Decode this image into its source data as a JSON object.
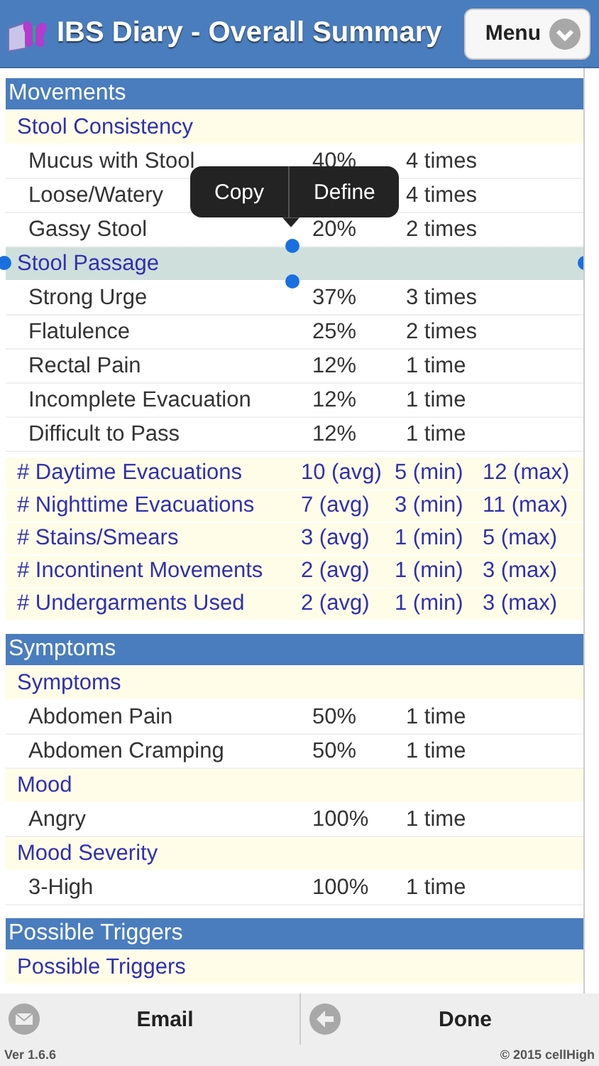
{
  "header": {
    "title": "IBS Diary - Overall Summary",
    "menu_button": "Menu"
  },
  "sections": [
    {
      "title": "Movements",
      "rows": [
        {
          "kind": "group",
          "label": "Stool Consistency",
          "selected": false
        },
        {
          "kind": "item",
          "label": "Mucus with Stool",
          "percent": "40%",
          "count": "4 times"
        },
        {
          "kind": "item",
          "label": "Loose/Watery",
          "count": "4 times"
        },
        {
          "kind": "item",
          "label": "Gassy Stool",
          "percent": "20%",
          "count": "2 times"
        },
        {
          "kind": "group",
          "label": "Stool Passage",
          "selected": true
        },
        {
          "kind": "item",
          "label": "Strong Urge",
          "percent": "37%",
          "count": "3 times"
        },
        {
          "kind": "item",
          "label": "Flatulence",
          "percent": "25%",
          "count": "2 times"
        },
        {
          "kind": "item",
          "label": "Rectal Pain",
          "percent": "12%",
          "count": "1 time"
        },
        {
          "kind": "item",
          "label": "Incomplete Evacuation",
          "percent": "12%",
          "count": "1 time"
        },
        {
          "kind": "item",
          "label": "Difficult to Pass",
          "percent": "12%",
          "count": "1 time"
        },
        {
          "kind": "stat",
          "label": "# Daytime Evacuations",
          "avg": "10 (avg)",
          "min": "5 (min)",
          "max": "12 (max)"
        },
        {
          "kind": "stat",
          "label": "# Nighttime Evacuations",
          "avg": "7 (avg)",
          "min": "3 (min)",
          "max": "11 (max)"
        },
        {
          "kind": "stat",
          "label": "# Stains/Smears",
          "avg": "3 (avg)",
          "min": "1 (min)",
          "max": "5 (max)"
        },
        {
          "kind": "stat",
          "label": "# Incontinent Movements",
          "avg": "2 (avg)",
          "min": "1 (min)",
          "max": "3 (max)"
        },
        {
          "kind": "stat",
          "label": "# Undergarments Used",
          "avg": "2 (avg)",
          "min": "1 (min)",
          "max": "3 (max)"
        }
      ]
    },
    {
      "title": "Symptoms",
      "rows": [
        {
          "kind": "group",
          "label": "Symptoms",
          "selected": false
        },
        {
          "kind": "item",
          "label": "Abdomen Pain",
          "percent": "50%",
          "count": "1 time"
        },
        {
          "kind": "item",
          "label": "Abdomen Cramping",
          "percent": "50%",
          "count": "1 time"
        },
        {
          "kind": "group",
          "label": "Mood",
          "selected": false
        },
        {
          "kind": "item",
          "label": "Angry",
          "percent": "100%",
          "count": "1 time"
        },
        {
          "kind": "group",
          "label": "Mood Severity",
          "selected": false
        },
        {
          "kind": "item",
          "label": "3-High",
          "percent": "100%",
          "count": "1 time"
        }
      ]
    },
    {
      "title": "Possible Triggers",
      "rows": [
        {
          "kind": "group",
          "label": "Possible Triggers",
          "selected": false
        }
      ]
    }
  ],
  "edit_menu": {
    "actions": [
      "Copy",
      "Define"
    ]
  },
  "footer": {
    "email_button": "Email",
    "done_button": "Done",
    "version": "Ver 1.6.6",
    "copyright": "© 2015 cellHigh"
  }
}
